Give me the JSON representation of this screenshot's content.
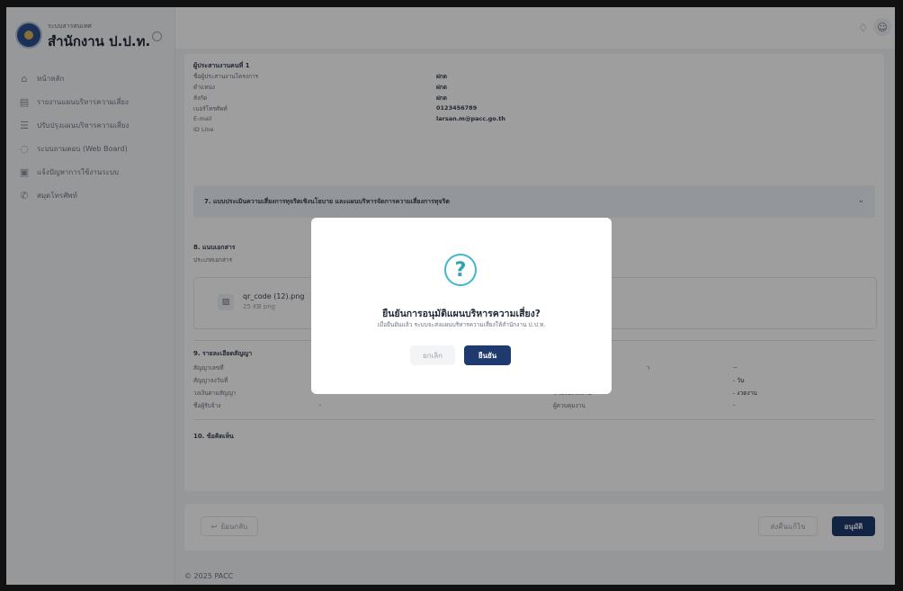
{
  "sidebar": {
    "brand_subtitle": "ระบบสารสนเทศ",
    "brand_title": "สำนักงาน ป.ป.ท.",
    "items": [
      {
        "label": "หน้าหลัก",
        "icon": "home-icon"
      },
      {
        "label": "รายงานแผนบริหารความเสี่ยง",
        "icon": "document-icon"
      },
      {
        "label": "ปรับปรุงแผนบริหารความเสี่ยง",
        "icon": "list-icon"
      },
      {
        "label": "ระบบถามตอบ (Web Board)",
        "icon": "chat-icon"
      },
      {
        "label": "แจ้งปัญหาการใช้งานระบบ",
        "icon": "report-icon"
      },
      {
        "label": "สมุดโทรศัพท์",
        "icon": "phone-icon"
      }
    ]
  },
  "coordinator": {
    "title": "ผู้ประสานงานคนที่ 1",
    "rows": [
      {
        "label": "ชื่อผู้ประสานงานโครงการ",
        "value": "ฝกด"
      },
      {
        "label": "ตำแหน่ง",
        "value": "ฝกด"
      },
      {
        "label": "สังกัด",
        "value": "ฝกด"
      },
      {
        "label": "เบอร์โทรศัพท์",
        "value": "0123456789"
      },
      {
        "label": "E-mail",
        "value": "larsan.m@pacc.go.th"
      },
      {
        "label": "ID Line",
        "value": ""
      }
    ]
  },
  "accordion": {
    "label": "7. แบบประเมินความเสี่ยงการทุจริตเชิงนโยบาย และแผนบริหารจัดการความเสี่ยงการทุจริต"
  },
  "documents": {
    "title": "8. แนบเอกสาร",
    "subtitle": "ประเภทเอกสาร",
    "file_name": "qr_code (12).png",
    "file_size": "25 KB png"
  },
  "contract": {
    "title": "9. รายละเอียดสัญญา",
    "left": [
      {
        "label": "สัญญาเลขที่",
        "value": ""
      },
      {
        "label": "สัญญาลงวันที่",
        "value": ""
      },
      {
        "label": "วงเงินตามสัญญา",
        "value": "-"
      },
      {
        "label": "ชื่อผู้รับจ้าง",
        "value": "-"
      }
    ],
    "right": [
      {
        "label": "า",
        "value": "--"
      },
      {
        "label": "",
        "value": "- วัน"
      },
      {
        "label": "จำนวนงวดงาน",
        "value": "- งวดงาน"
      },
      {
        "label": "ผู้ควบคุมงาน",
        "value": "-"
      }
    ]
  },
  "comments": {
    "title": "10. ข้อคิดเห็น"
  },
  "footer": {
    "back_label": "ย้อนกลับ",
    "return_label": "ส่งคืนแก้ไข",
    "approve_label": "อนุมัติ",
    "copyright": "© 2025 PACC"
  },
  "modal": {
    "icon_glyph": "?",
    "title": "ยืนยันการอนุมัติแผนบริหารความเสี่ยง?",
    "message": "เมื่อยืนยันแล้ว ระบบจะส่งแผนบริหารความเสี่ยงให้สำนักงาน ป.ป.ท.",
    "cancel_label": "ยกเลิก",
    "confirm_label": "ยืนยัน"
  },
  "colors": {
    "primary": "#1e3a6e",
    "accent": "#3fb8c9"
  }
}
